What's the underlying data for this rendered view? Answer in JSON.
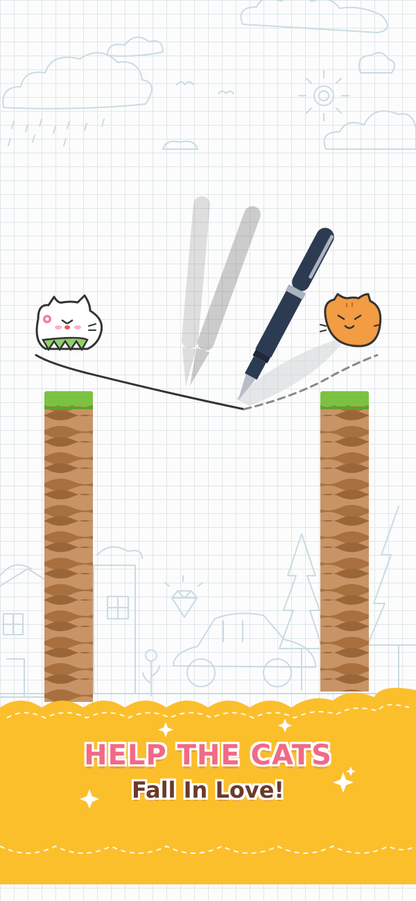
{
  "banner": {
    "headline": "HELP THE CATS",
    "subline": "Fall In Love!"
  },
  "colors": {
    "banner_yellow": "#fbbf2c",
    "headline_pink": "#f06a86",
    "subline_brown": "#6b3a2a",
    "grass_green": "#7cc242",
    "dirt_brown": "#b07a4b",
    "pen_navy": "#2d3b52"
  },
  "icons": [
    "white-cat-icon",
    "orange-cat-icon",
    "pen-icon",
    "sparkle-icon",
    "cloud-icon",
    "sun-icon",
    "tree-icon",
    "car-icon",
    "house-icon",
    "diamond-icon",
    "flower-icon"
  ]
}
